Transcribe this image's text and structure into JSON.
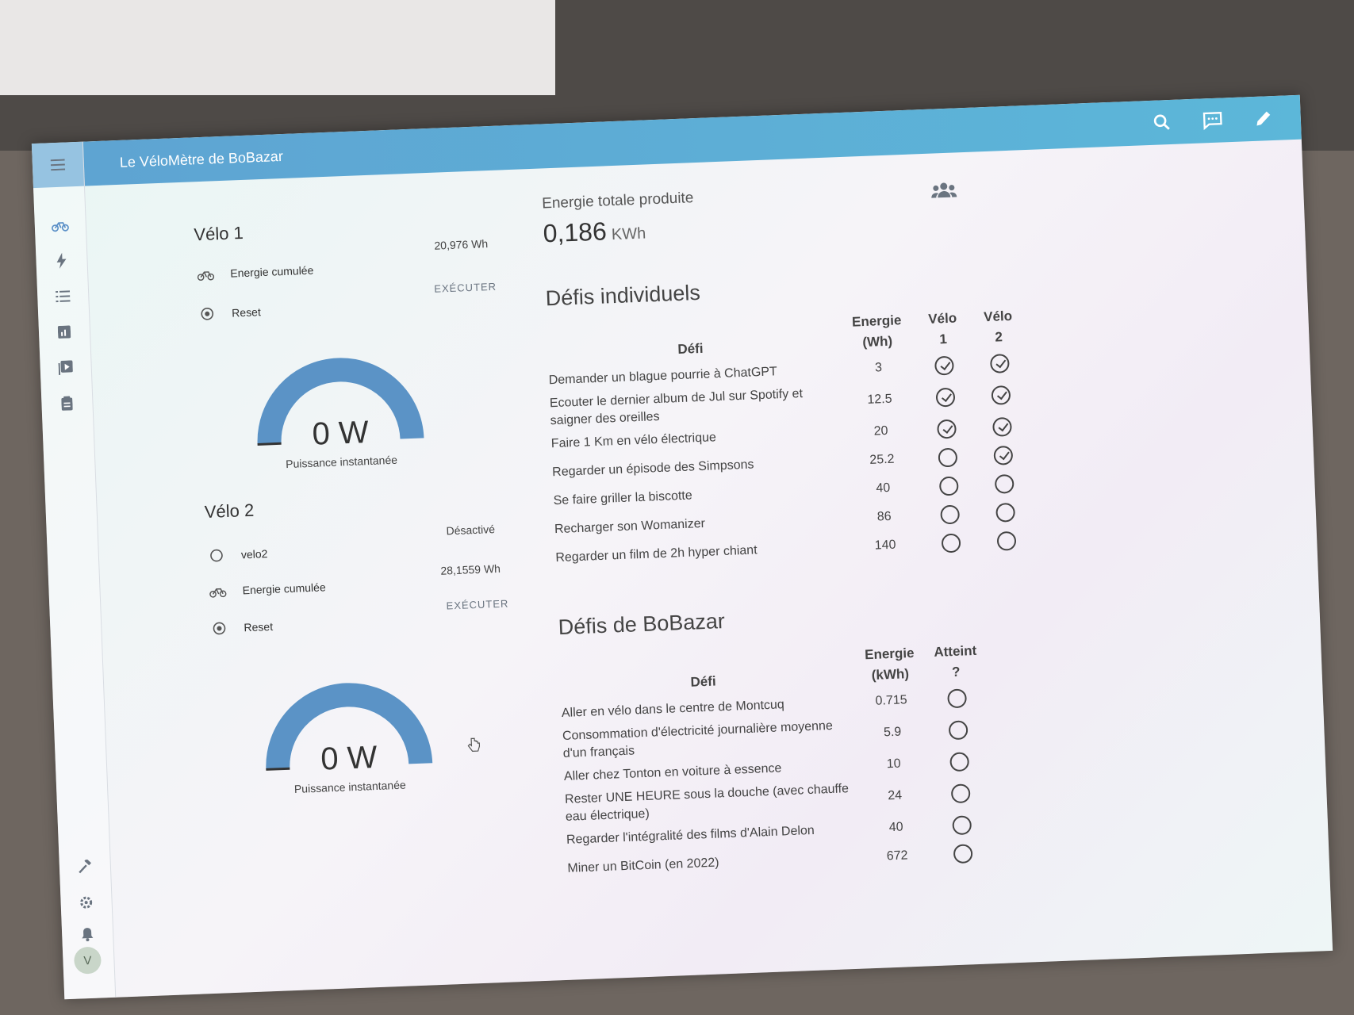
{
  "app": {
    "title": "Le VéloMètre de BoBazar"
  },
  "topbar": {
    "icons": [
      "search-icon",
      "chat-icon",
      "edit-icon"
    ]
  },
  "sidebar": {
    "items": [
      "bike-icon",
      "lightning-icon",
      "list-icon",
      "chart-icon",
      "media-icon",
      "clipboard-icon"
    ],
    "bottom_items": [
      "hammer-icon",
      "gear-icon",
      "bell-icon"
    ],
    "avatar": "V"
  },
  "velo1": {
    "title": "Vélo 1",
    "energy_label": "Energie cumulée",
    "energy_value": "20,976 Wh",
    "reset_label": "Reset",
    "reset_action": "EXÉCUTER",
    "gauge_value": "0 W",
    "gauge_level": 0,
    "gauge_label": "Puissance instantanée"
  },
  "velo2": {
    "title": "Vélo 2",
    "switch_label": "velo2",
    "switch_state": "Désactivé",
    "energy_label": "Energie cumulée",
    "energy_value": "28,1559 Wh",
    "reset_label": "Reset",
    "reset_action": "EXÉCUTER",
    "gauge_value": "0 W",
    "gauge_level": 0,
    "gauge_label": "Puissance instantanée"
  },
  "total": {
    "label": "Energie totale produite",
    "value": "0,186",
    "unit": "KWh"
  },
  "defis_individuels": {
    "title": "Défis individuels",
    "headers": {
      "defi": "Défi",
      "energie_1": "Energie",
      "energie_2": "(Wh)",
      "velo1_1": "Vélo",
      "velo1_2": "1",
      "velo2_1": "Vélo",
      "velo2_2": "2"
    },
    "rows": [
      {
        "defi": "Demander un blague pourrie à ChatGPT",
        "energie": "3",
        "velo1": true,
        "velo2": true
      },
      {
        "defi": "Ecouter le dernier album de Jul sur Spotify et saigner des oreilles",
        "energie": "12.5",
        "velo1": true,
        "velo2": true
      },
      {
        "defi": "Faire 1 Km en vélo électrique",
        "energie": "20",
        "velo1": true,
        "velo2": true
      },
      {
        "defi": "Regarder un épisode des Simpsons",
        "energie": "25.2",
        "velo1": false,
        "velo2": true
      },
      {
        "defi": "Se faire griller la biscotte",
        "energie": "40",
        "velo1": false,
        "velo2": false
      },
      {
        "defi": "Recharger son Womanizer",
        "energie": "86",
        "velo1": false,
        "velo2": false
      },
      {
        "defi": "Regarder un film de 2h hyper chiant",
        "energie": "140",
        "velo1": false,
        "velo2": false
      }
    ]
  },
  "defis_bobazar": {
    "title": "Défis de BoBazar",
    "headers": {
      "defi": "Défi",
      "energie_1": "Energie",
      "energie_2": "(kWh)",
      "atteint_1": "Atteint",
      "atteint_2": "?"
    },
    "rows": [
      {
        "defi": "Aller en vélo dans le centre de Montcuq",
        "energie": "0.715",
        "atteint": false
      },
      {
        "defi": "Consommation d'électricité journalière moyenne d'un français",
        "energie": "5.9",
        "atteint": false
      },
      {
        "defi": "Aller chez Tonton en voiture à essence",
        "energie": "10",
        "atteint": false
      },
      {
        "defi": "Rester UNE HEURE sous la douche (avec chauffe eau électrique)",
        "energie": "24",
        "atteint": false
      },
      {
        "defi": "Regarder l'intégralité des films d'Alain Delon",
        "energie": "40",
        "atteint": false
      },
      {
        "defi": "Miner un BitCoin (en 2022)",
        "energie": "672",
        "atteint": false
      }
    ]
  }
}
